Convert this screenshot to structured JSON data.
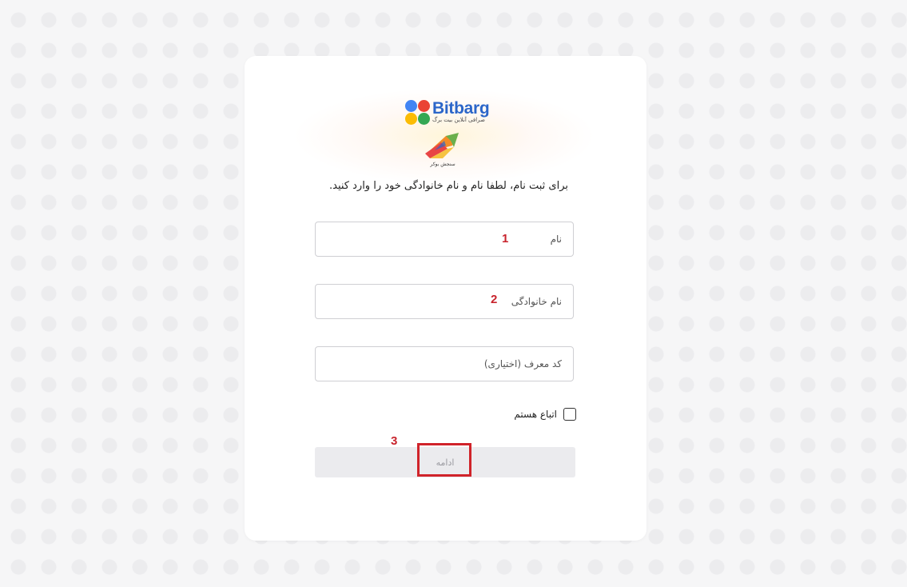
{
  "brand": {
    "name": "Bitbarg",
    "tagline": "صرافی آنلاین بیت برگ",
    "dot_colors": [
      "#4285f4",
      "#ea4335",
      "#fbbc05",
      "#34a853"
    ]
  },
  "partner": {
    "name": "سنجش بوکر"
  },
  "intro_text": "برای ثبت نام، لطفا نام و نام خانوادگی خود را وارد کنید.",
  "form": {
    "first_name": {
      "placeholder": "نام",
      "value": ""
    },
    "last_name": {
      "placeholder": "نام خانوادگی",
      "value": ""
    },
    "referral_code": {
      "placeholder": "کد معرف (اختیاری)",
      "value": ""
    },
    "foreign_national": {
      "label": "اتباع هستم",
      "checked": false
    },
    "submit_label": "ادامه"
  },
  "annotations": {
    "marker_1": "1",
    "marker_2": "2",
    "marker_3": "3",
    "highlight_color": "#d0232a"
  }
}
